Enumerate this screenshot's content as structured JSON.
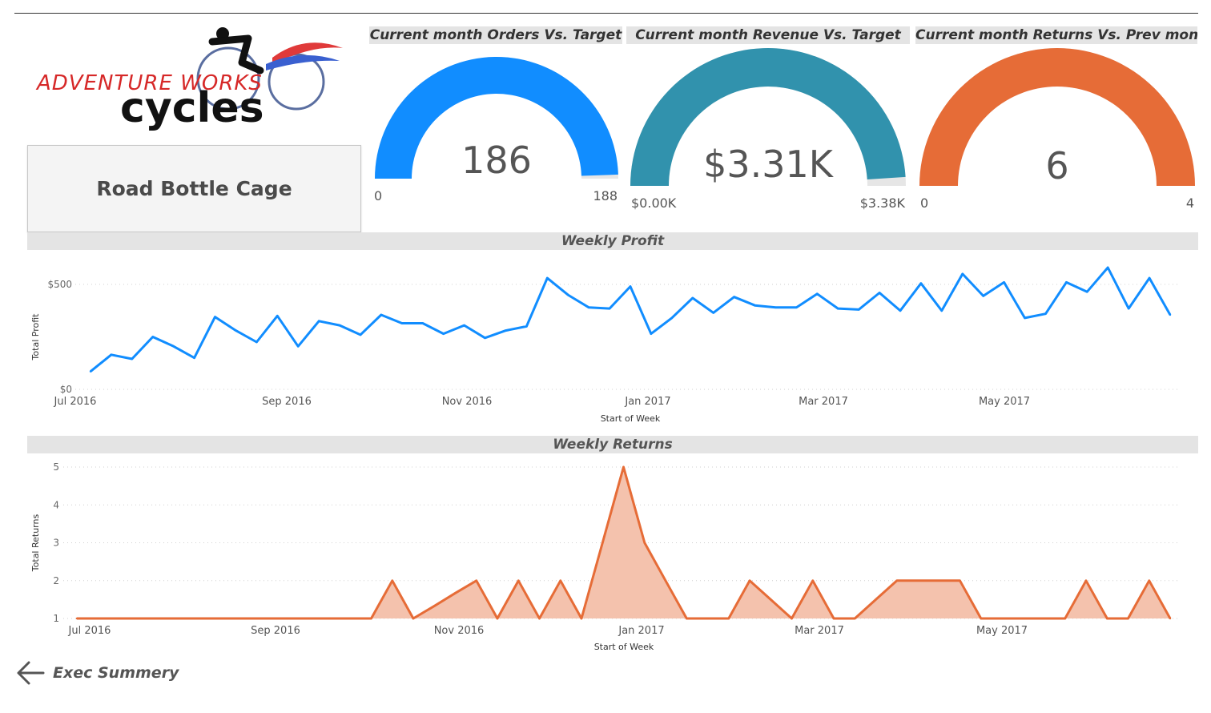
{
  "logo": {
    "line1": "ADVENTURE WORKS",
    "line2": "cycles"
  },
  "product": {
    "name": "Road Bottle Cage"
  },
  "gauges": [
    {
      "title": "Current month Orders Vs. Target",
      "value_label": "186",
      "value": 186,
      "min_label": "0",
      "max_label": "188",
      "min": 0,
      "max": 188,
      "color": "#118DFF"
    },
    {
      "title": "Current month Revenue Vs. Target",
      "value_label": "$3.31K",
      "value": 3.31,
      "min_label": "$0.00K",
      "max_label": "$3.38K",
      "min": 0,
      "max": 3.38,
      "color": "#3192AD"
    },
    {
      "title": "Current month Returns Vs. Prev month",
      "value_label": "6",
      "value": 6,
      "min_label": "0",
      "max_label": "4",
      "min": 0,
      "max": 4,
      "color": "#E66C37"
    }
  ],
  "profit_section": {
    "title": "Weekly Profit"
  },
  "returns_section": {
    "title": "Weekly Returns"
  },
  "nav": {
    "back_label": "Exec Summery"
  },
  "chart_data": [
    {
      "type": "line",
      "title": "Weekly Profit",
      "xlabel": "Start of Week",
      "ylabel": "Total Profit",
      "ylim": [
        0,
        500
      ],
      "yticks": [
        "$0",
        "$500"
      ],
      "xticks": [
        "Jul 2016",
        "Sep 2016",
        "Nov 2016",
        "Jan 2017",
        "Mar 2017",
        "May 2017"
      ],
      "grid": true,
      "color": "#118DFF",
      "series": [
        {
          "values": [
            85,
            165,
            145,
            250,
            205,
            150,
            345,
            280,
            225,
            350,
            205,
            325,
            305,
            260,
            355,
            315,
            315,
            265,
            305,
            245,
            280,
            300,
            530,
            450,
            390,
            385,
            490,
            265,
            340,
            435,
            365,
            440,
            400,
            390,
            390,
            455,
            385,
            380,
            460,
            375,
            505,
            375,
            550,
            445,
            510,
            340,
            360,
            510,
            465,
            580,
            385,
            530,
            355
          ]
        }
      ]
    },
    {
      "type": "area",
      "title": "Weekly Returns",
      "xlabel": "Start of Week",
      "ylabel": "Total Returns",
      "ylim": [
        1,
        5
      ],
      "yticks": [
        "1",
        "2",
        "3",
        "4",
        "5"
      ],
      "xticks": [
        "Jul 2016",
        "Sep 2016",
        "Nov 2016",
        "Jan 2017",
        "Mar 2017",
        "May 2017"
      ],
      "grid": true,
      "color": "#E66C37",
      "fill": "#F4C2AD",
      "series": [
        {
          "values": [
            1,
            1,
            1,
            1,
            1,
            1,
            1,
            1,
            1,
            1,
            1,
            1,
            1,
            1,
            1,
            2,
            1,
            1.33,
            1.67,
            2,
            1,
            2,
            1,
            2,
            1,
            3,
            5,
            3,
            2,
            1,
            1,
            1,
            2,
            1.5,
            1,
            2,
            1,
            1,
            1.5,
            2,
            2,
            2,
            2,
            1,
            1,
            1,
            1,
            1,
            2,
            1,
            1,
            2,
            1
          ]
        }
      ]
    }
  ]
}
